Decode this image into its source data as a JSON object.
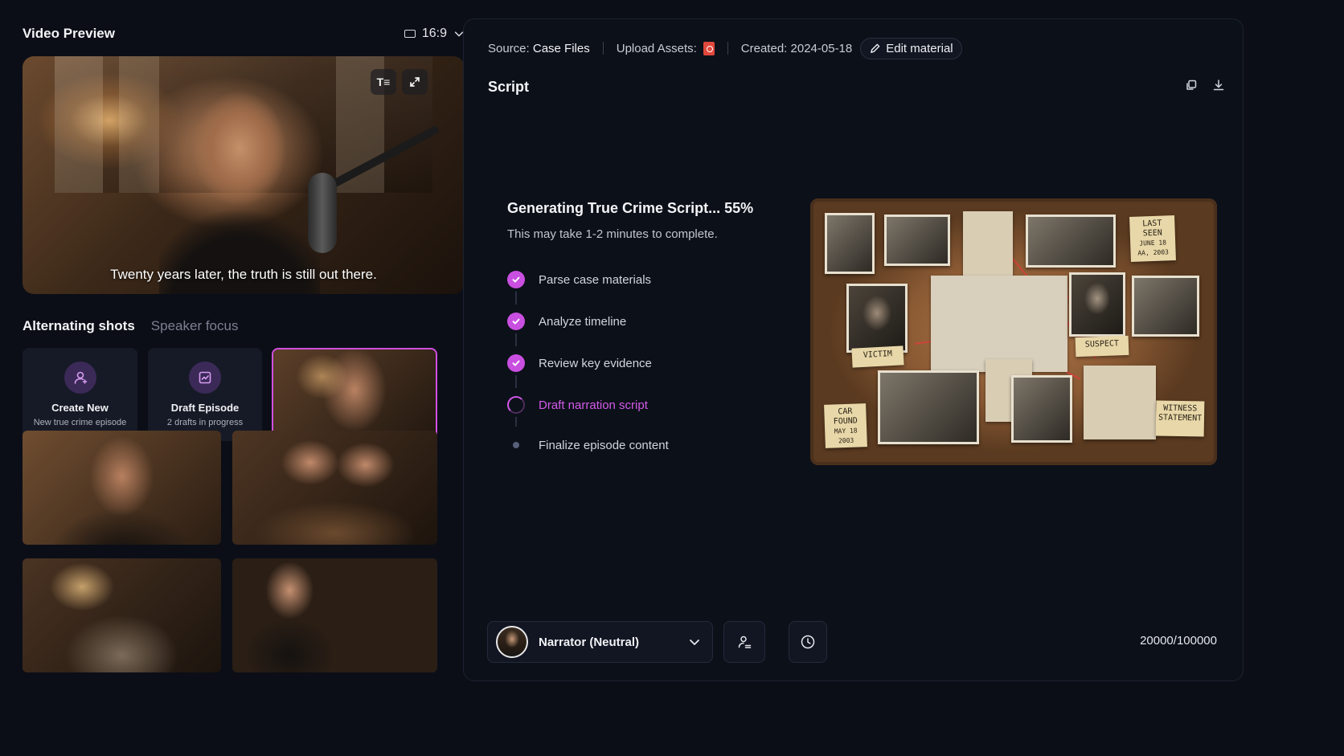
{
  "preview": {
    "title": "Video Preview",
    "aspect_ratio": "16:9",
    "caption": "Twenty years later, the truth is still out there.",
    "text_style_glyph": "T≡"
  },
  "shots": {
    "tabs": [
      {
        "label": "Alternating shots",
        "active": true
      },
      {
        "label": "Speaker focus",
        "active": false
      }
    ],
    "create_new": {
      "title": "Create New",
      "subtitle": "New true crime episode"
    },
    "draft_episode": {
      "title": "Draft Episode",
      "subtitle": "2 drafts in progress"
    }
  },
  "meta": {
    "source_label": "Source:",
    "source_value": "Case Files",
    "upload_label": "Upload Assets:",
    "created_label": "Created:",
    "created_value": "2024-05-18",
    "edit_label": "Edit material"
  },
  "script": {
    "title": "Script",
    "generating_title": "Generating True Crime Script... 55%",
    "progress_percent": 55,
    "generating_subtitle": "This may take 1-2 minutes to complete.",
    "steps": [
      {
        "label": "Parse case materials",
        "status": "done"
      },
      {
        "label": "Analyze timeline",
        "status": "done"
      },
      {
        "label": "Review key evidence",
        "status": "done"
      },
      {
        "label": "Draft narration script",
        "status": "in-progress"
      },
      {
        "label": "Finalize episode content",
        "status": "pending"
      }
    ],
    "board_notes": {
      "last_seen": "LAST SEEN",
      "last_seen_date": "JUNE 18 AA, 2003",
      "victim": "VICTIM",
      "suspect": "SUSPECT",
      "car_found": "CAR FOUND",
      "car_found_date": "MAY 18 2003",
      "witness": "WITNESS STATEMENT"
    }
  },
  "footer": {
    "voice": "Narrator (Neutral)",
    "counter": "20000/100000"
  },
  "colors": {
    "accent": "#c94fe0",
    "background": "#0b0e17",
    "panel": "#0c1019",
    "card": "#161a26"
  }
}
